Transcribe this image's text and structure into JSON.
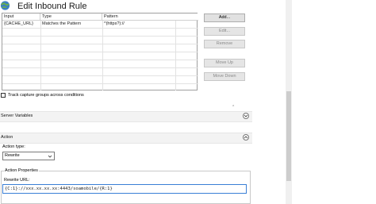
{
  "window": {
    "title": "Edit Inbound Rule"
  },
  "conditions": {
    "columns": [
      "Input",
      "Type",
      "Pattern"
    ],
    "rows": [
      [
        "{CACHE_URL}",
        "Matches the Pattern",
        "^(https?)://"
      ]
    ],
    "buttons": {
      "add": "Add...",
      "edit": "Edit...",
      "remove": "Remove",
      "move_up": "Move Up",
      "move_down": "Move Down"
    },
    "track_capture_label": "Track capture groups across conditions"
  },
  "server_variables": {
    "title": "Server Variables"
  },
  "action": {
    "title": "Action",
    "type_label": "Action type:",
    "type_value": "Rewrite",
    "properties_title": "Action Properties",
    "rewrite_url_label": "Rewrite URL:",
    "rewrite_url_value": "{C:1}://xxx.xx.xx.xx:4443/soamobile/{R:1}"
  }
}
